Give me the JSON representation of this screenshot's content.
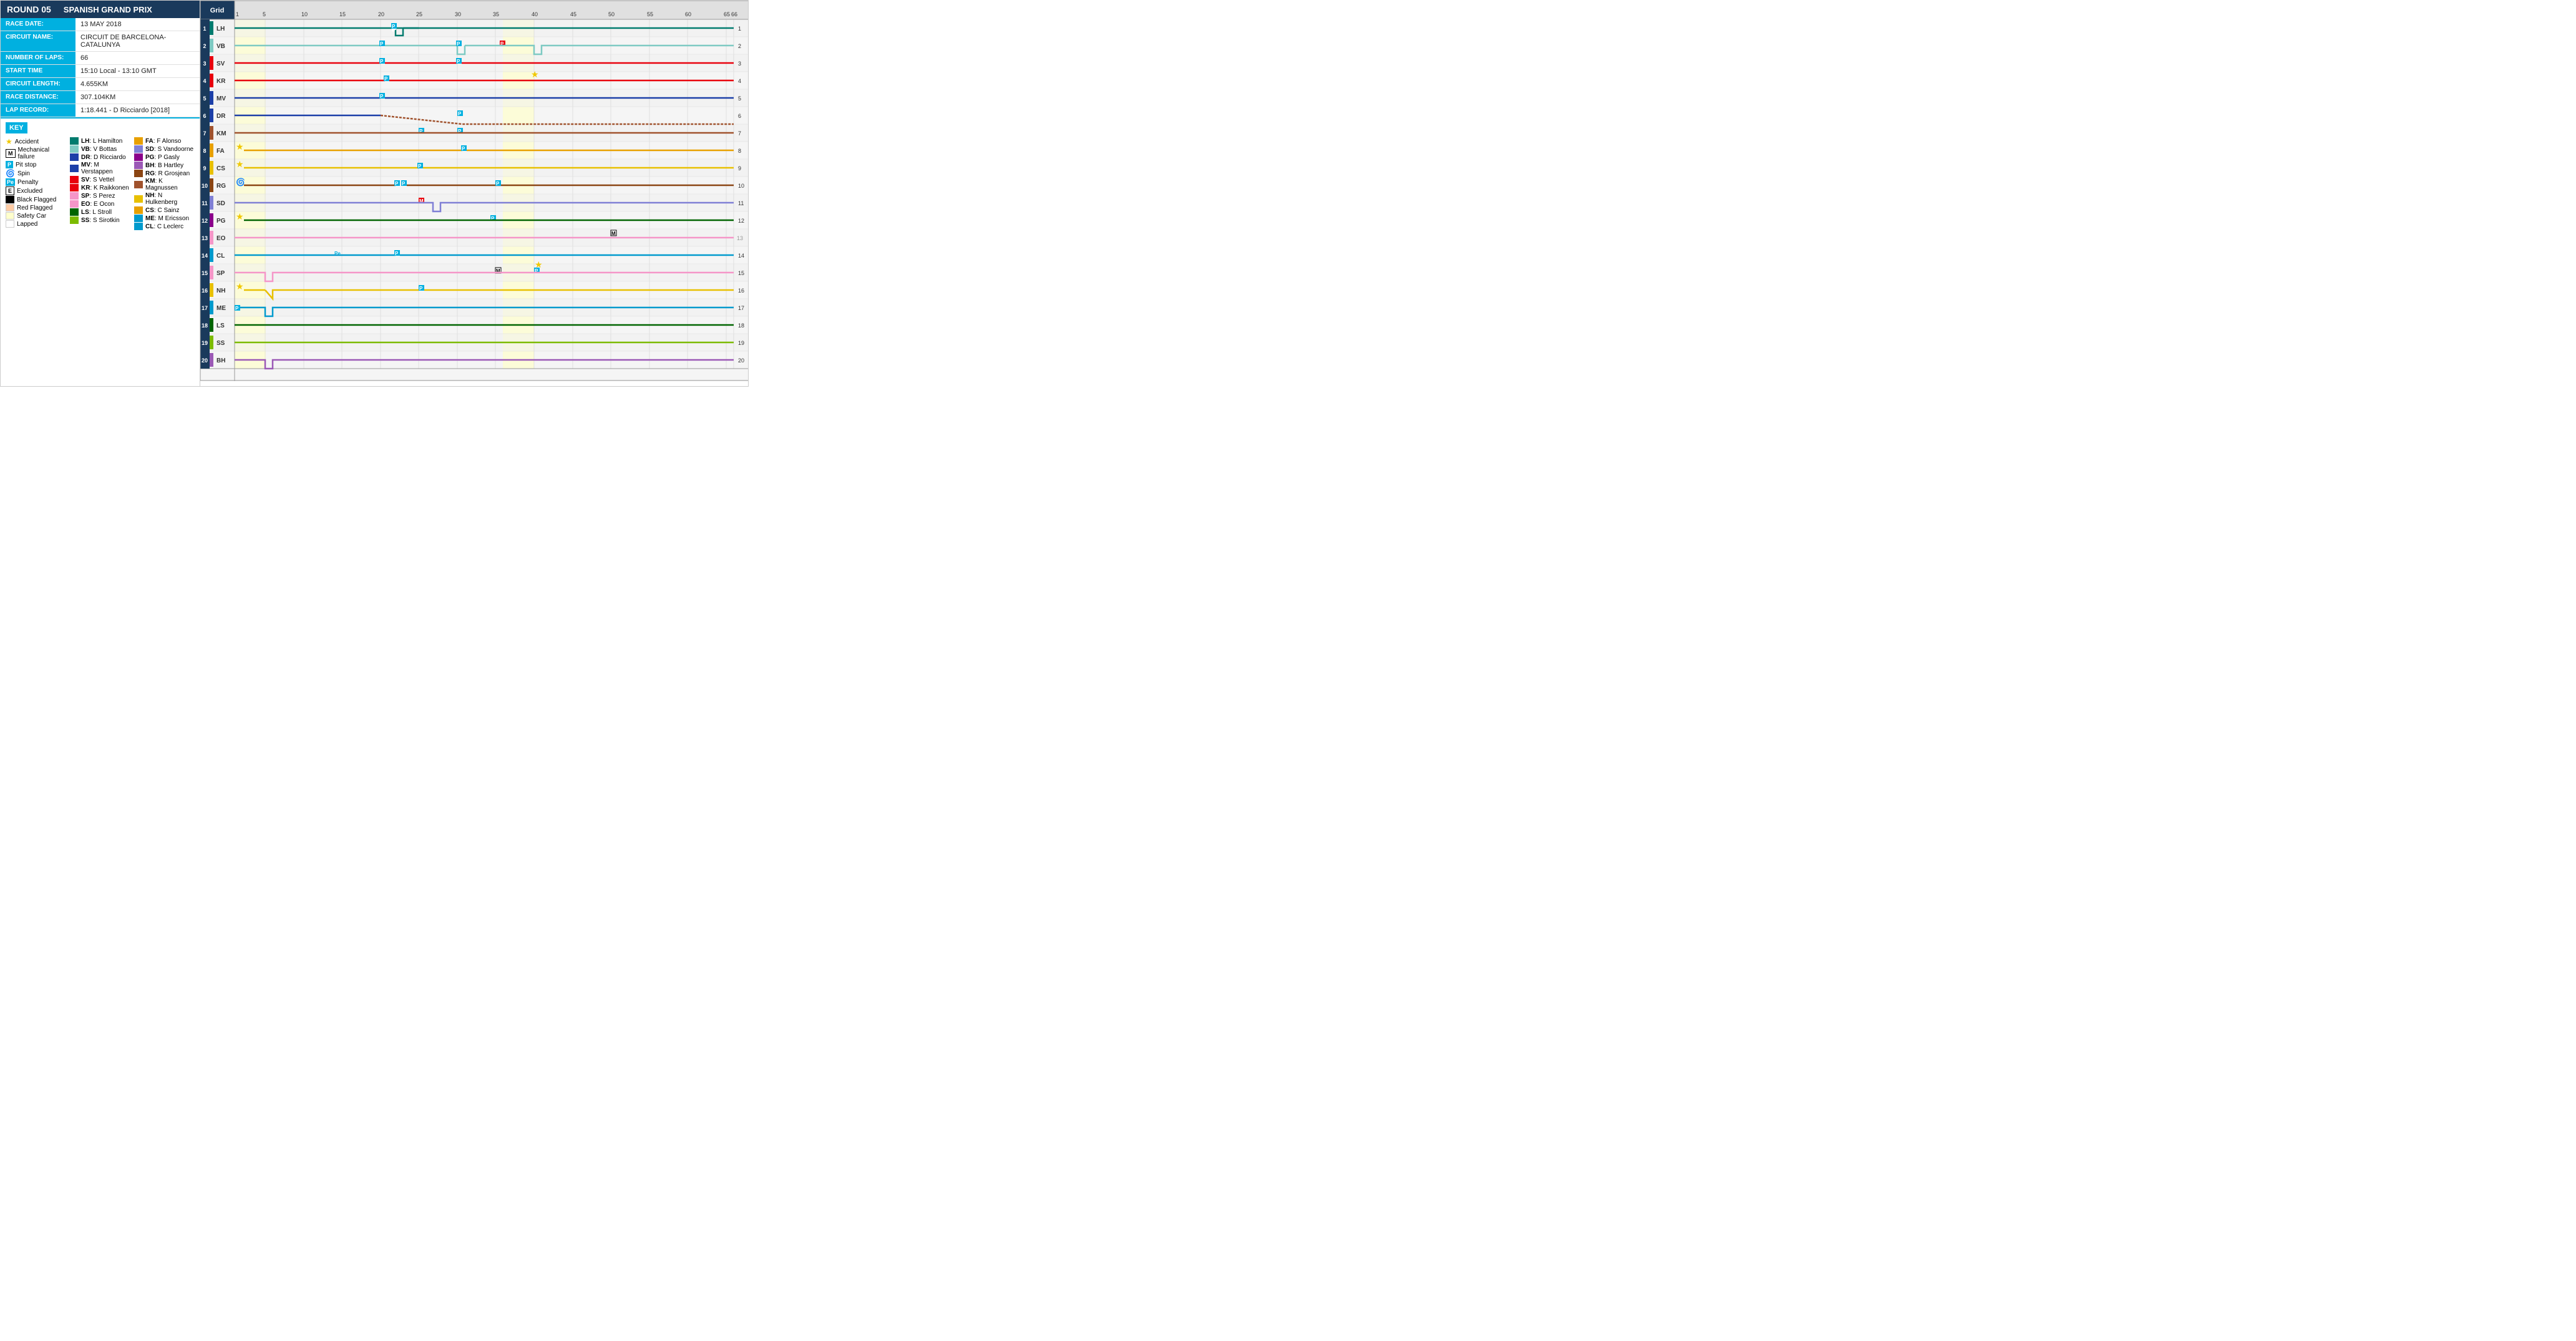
{
  "header": {
    "round": "ROUND 05",
    "race_title": "SPANISH GRAND PRIX"
  },
  "info": [
    {
      "label": "RACE DATE:",
      "value": "13 MAY 2018"
    },
    {
      "label": "CIRCUIT NAME:",
      "value": "CIRCUIT DE BARCELONA-CATALUNYA"
    },
    {
      "label": "NUMBER OF LAPS:",
      "value": "66"
    },
    {
      "label": "START TIME",
      "value": "15:10 Local - 13:10 GMT"
    },
    {
      "label": "CIRCUIT LENGTH:",
      "value": "4.655KM"
    },
    {
      "label": "RACE DISTANCE:",
      "value": "307.104KM"
    },
    {
      "label": "LAP RECORD:",
      "value": "1:18.441 - D Ricciardo [2018]"
    }
  ],
  "key": {
    "title": "KEY",
    "symbols": [
      {
        "icon": "star",
        "label": "Accident"
      },
      {
        "icon": "M",
        "label": "Mechanical failure"
      },
      {
        "icon": "P",
        "label": "Pit stop"
      },
      {
        "icon": "spin",
        "label": "Spin"
      },
      {
        "icon": "Pe",
        "label": "Penalty"
      },
      {
        "icon": "E",
        "label": "Excluded"
      },
      {
        "icon": "black",
        "label": "Black Flagged"
      },
      {
        "icon": "red-flag",
        "label": "Red Flagged"
      },
      {
        "icon": "safety",
        "label": "Safety Car"
      },
      {
        "icon": "lapped",
        "label": "Lapped"
      }
    ],
    "drivers_col1": [
      {
        "abbr": "LH",
        "color": "#007b6e",
        "name": "L Hamilton"
      },
      {
        "abbr": "VB",
        "color": "#7ecac3",
        "name": "V Bottas"
      },
      {
        "abbr": "DR",
        "color": "#1c3fa8",
        "name": "D Ricciardo"
      },
      {
        "abbr": "MV",
        "color": "#1c3fa8",
        "name": "M Verstappen"
      },
      {
        "abbr": "SV",
        "color": "#e8000d",
        "name": "S Vettel"
      },
      {
        "abbr": "KR",
        "color": "#e8000d",
        "name": "K Raikkonen"
      },
      {
        "abbr": "SP",
        "color": "#f596c8",
        "name": "S Perez"
      },
      {
        "abbr": "EO",
        "color": "#f596c8",
        "name": "E Ocon"
      },
      {
        "abbr": "LS",
        "color": "#006400",
        "name": "L Stroll"
      },
      {
        "abbr": "SS",
        "color": "#7cbb00",
        "name": "S Sirotkin"
      }
    ],
    "drivers_col2": [
      {
        "abbr": "FA",
        "color": "#e8a000",
        "name": "F Alonso"
      },
      {
        "abbr": "SD",
        "color": "#7f7fd5",
        "name": "S Vandoorne"
      },
      {
        "abbr": "PG",
        "color": "#8b008b",
        "name": "P Gasly"
      },
      {
        "abbr": "BH",
        "color": "#9b59b6",
        "name": "B Hartley"
      },
      {
        "abbr": "RG",
        "color": "#8b4513",
        "name": "R Grosjean"
      },
      {
        "abbr": "KM",
        "color": "#a0522d",
        "name": "K Magnussen"
      },
      {
        "abbr": "NH",
        "color": "#e8c000",
        "name": "N Hulkenberg"
      },
      {
        "abbr": "CS",
        "color": "#e8a000",
        "name": "C Sainz"
      },
      {
        "abbr": "ME",
        "color": "#009acd",
        "name": "M Ericsson"
      },
      {
        "abbr": "CL",
        "color": "#009acd",
        "name": "C Leclerc"
      }
    ]
  },
  "chart": {
    "total_laps": 66,
    "grid_header": "Grid",
    "drivers": [
      {
        "pos": 1,
        "abbr": "LH",
        "color": "#007b6e",
        "start_color": "#007b6e"
      },
      {
        "pos": 2,
        "abbr": "VB",
        "color": "#7ecac3",
        "start_color": "#7ecac3"
      },
      {
        "pos": 3,
        "abbr": "SV",
        "color": "#e8000d",
        "start_color": "#e8000d"
      },
      {
        "pos": 4,
        "abbr": "KR",
        "color": "#e8000d",
        "start_color": "#e8000d"
      },
      {
        "pos": 5,
        "abbr": "MV",
        "color": "#1c3fa8",
        "start_color": "#1c3fa8"
      },
      {
        "pos": 6,
        "abbr": "DR",
        "color": "#1c3fa8",
        "start_color": "#1c3fa8"
      },
      {
        "pos": 7,
        "abbr": "KM",
        "color": "#a0522d",
        "start_color": "#a0522d"
      },
      {
        "pos": 8,
        "abbr": "FA",
        "color": "#e8a000",
        "start_color": "#e8a000"
      },
      {
        "pos": 9,
        "abbr": "CS",
        "color": "#e8a000",
        "start_color": "#e8a000"
      },
      {
        "pos": 10,
        "abbr": "RG",
        "color": "#8b4513",
        "start_color": "#8b4513"
      },
      {
        "pos": 11,
        "abbr": "SD",
        "color": "#7f7fd5",
        "start_color": "#7f7fd5"
      },
      {
        "pos": 12,
        "abbr": "PG",
        "color": "#8b008b",
        "start_color": "#8b008b"
      },
      {
        "pos": 13,
        "abbr": "EO",
        "color": "#f596c8",
        "start_color": "#f596c8"
      },
      {
        "pos": 14,
        "abbr": "CL",
        "color": "#009acd",
        "start_color": "#009acd"
      },
      {
        "pos": 15,
        "abbr": "SP",
        "color": "#f596c8",
        "start_color": "#f596c8"
      },
      {
        "pos": 16,
        "abbr": "NH",
        "color": "#e8c000",
        "start_color": "#e8c000"
      },
      {
        "pos": 17,
        "abbr": "ME",
        "color": "#009acd",
        "start_color": "#009acd"
      },
      {
        "pos": 18,
        "abbr": "LS",
        "color": "#006400",
        "start_color": "#006400"
      },
      {
        "pos": 19,
        "abbr": "SS",
        "color": "#7cbb00",
        "start_color": "#7cbb00"
      },
      {
        "pos": 20,
        "abbr": "BH",
        "color": "#9b59b6",
        "start_color": "#9b59b6"
      }
    ]
  }
}
